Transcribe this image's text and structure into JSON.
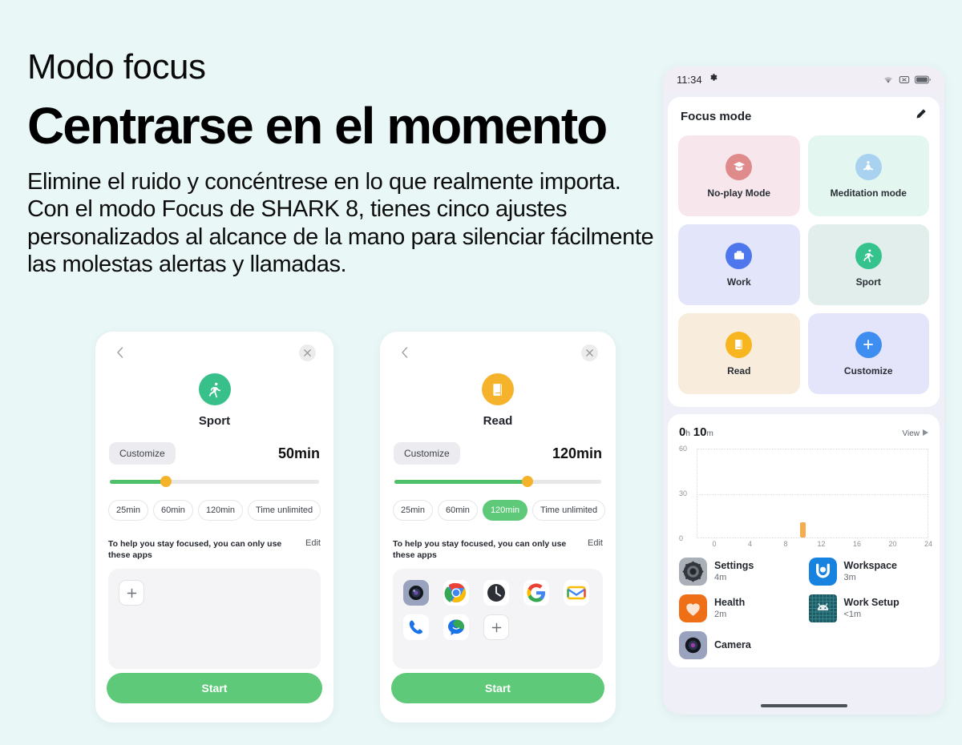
{
  "page": {
    "background": "#eaf7f7",
    "eyebrow": "Modo focus",
    "headline": "Centrarse en el momento",
    "lede": "Elimine el ruido y concéntrese en lo que realmente importa. Con el modo Focus de SHARK 8, tienes cinco ajustes personalizados al alcance de la mano para silenciar fácilmente las molestas alertas y llamadas."
  },
  "colors": {
    "green": "#5ec979",
    "amber": "#f5b32c",
    "blue": "#3d7ff0",
    "card_bg": "#ffffff"
  },
  "card_sport": {
    "back_icon": "chevron-left-icon",
    "close_icon": "close-icon",
    "mode_icon": "running-icon",
    "mode_icon_color": "#38c08a",
    "mode_name": "Sport",
    "customize_label": "Customize",
    "duration_value": "50min",
    "slider_percent": 27,
    "presets": [
      {
        "label": "25min",
        "active": false
      },
      {
        "label": "60min",
        "active": false
      },
      {
        "label": "120min",
        "active": false
      },
      {
        "label": "Time unlimited",
        "active": false
      }
    ],
    "apps_note": "To help you stay focused, you can only use these apps",
    "edit_label": "Edit",
    "apps": [],
    "add_icon": "plus-icon",
    "start_label": "Start"
  },
  "card_read": {
    "back_icon": "chevron-left-icon",
    "close_icon": "close-icon",
    "mode_icon": "book-icon",
    "mode_icon_color": "#f5b32c",
    "mode_name": "Read",
    "customize_label": "Customize",
    "duration_value": "120min",
    "slider_percent": 64,
    "presets": [
      {
        "label": "25min",
        "active": false
      },
      {
        "label": "60min",
        "active": false
      },
      {
        "label": "120min",
        "active": true
      },
      {
        "label": "Time unlimited",
        "active": false
      }
    ],
    "apps_note": "To help you stay focused, you can only use these apps",
    "edit_label": "Edit",
    "apps": [
      {
        "name": "camera-icon"
      },
      {
        "name": "chrome-icon"
      },
      {
        "name": "clock-icon"
      },
      {
        "name": "google-icon"
      },
      {
        "name": "gmail-icon"
      },
      {
        "name": "phone-icon"
      },
      {
        "name": "messages-icon"
      }
    ],
    "add_icon": "plus-icon",
    "start_label": "Start"
  },
  "phone": {
    "statusbar": {
      "time": "11:34",
      "gear_icon": "gear-icon",
      "wifi_icon": "wifi-icon",
      "nosim_icon": "no-sim-icon",
      "battery_icon": "battery-icon"
    },
    "focus_sheet": {
      "title": "Focus mode",
      "edit_icon": "pencil-icon",
      "tiles": [
        {
          "label": "No-play Mode",
          "icon": "graduation-cap-icon",
          "bubble": "#e08b8b",
          "bg": "#f7e6ec"
        },
        {
          "label": "Meditation mode",
          "icon": "meditation-icon",
          "bubble": "#a9d2f0",
          "bg": "#e3f6f0"
        },
        {
          "label": "Work",
          "icon": "briefcase-icon",
          "bubble": "#4e77ee",
          "bg": "#e3e5fa"
        },
        {
          "label": "Sport",
          "icon": "running-icon",
          "bubble": "#34c28d",
          "bg": "#e1eeeb"
        },
        {
          "label": "Read",
          "icon": "book-icon",
          "bubble": "#f7b51f",
          "bg": "#f8ecdc"
        },
        {
          "label": "Customize",
          "icon": "plus-circle-icon",
          "bubble": "#3d8ef0",
          "bg": "#e4e5fa"
        }
      ]
    },
    "stats_sheet": {
      "total_hours": "0",
      "hours_unit": "h",
      "total_minutes": "10",
      "minutes_unit": "m",
      "view_label": "View",
      "view_icon": "play-triangle-icon",
      "usage": [
        {
          "name": "Settings",
          "duration": "4m",
          "icon": "settings-icon"
        },
        {
          "name": "Workspace",
          "duration": "3m",
          "icon": "workspace-icon"
        },
        {
          "name": "Health",
          "duration": "2m",
          "icon": "health-icon"
        },
        {
          "name": "Work Setup",
          "duration": "<1m",
          "icon": "android-work-setup-icon"
        },
        {
          "name": "Camera",
          "duration": "",
          "icon": "camera-icon"
        }
      ],
      "home_indicator": "home-indicator"
    }
  },
  "chart_data": {
    "type": "bar",
    "title": "0 h 10 m",
    "xlabel": "",
    "ylabel": "",
    "x": [
      0,
      4,
      8,
      12,
      16,
      20,
      24
    ],
    "xtick_labels": [
      "0",
      "4",
      "8",
      "12",
      "16",
      "20",
      "24"
    ],
    "ytick_labels": [
      "0",
      "30",
      "60"
    ],
    "ylim": [
      0,
      60
    ],
    "xlim": [
      0,
      24
    ],
    "grid": true,
    "legend": "none",
    "bars": [
      {
        "x": 11,
        "value": 10,
        "color": "#f3ad4e"
      }
    ],
    "categories": [
      "11"
    ],
    "values": [
      10
    ]
  }
}
